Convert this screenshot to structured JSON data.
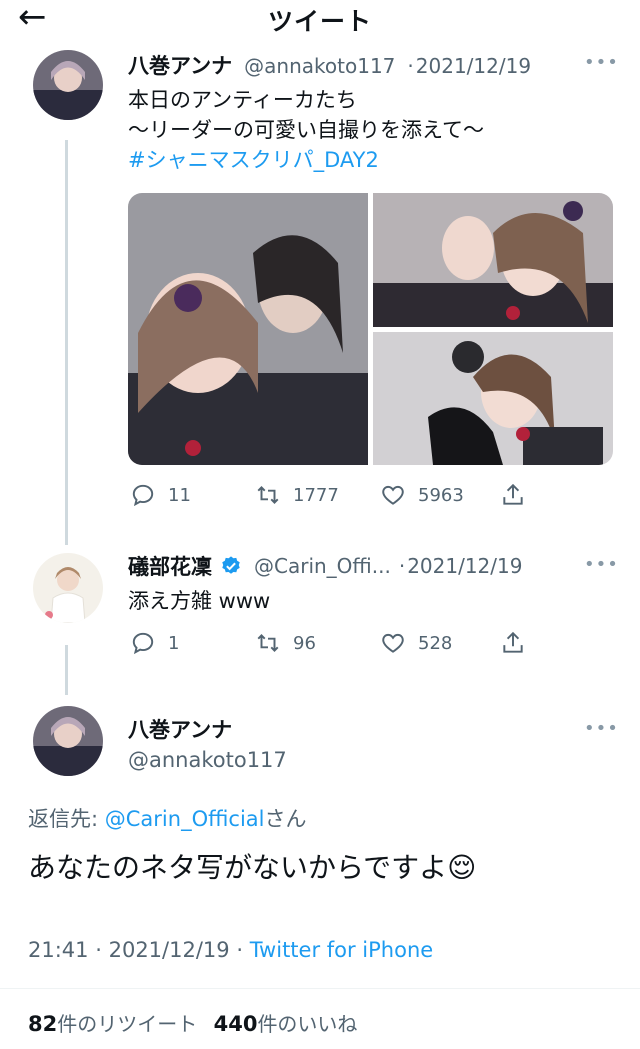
{
  "header": {
    "title": "ツイート"
  },
  "tweet1": {
    "name": "八巻アンナ",
    "handle": "@annakoto117",
    "date": "2021/12/19",
    "line1": "本日のアンティーカたち",
    "line2": "〜リーダーの可愛い自撮りを添えて〜",
    "hashtag": "#シャニマスクリパ_DAY2",
    "replies": "11",
    "retweets": "1777",
    "likes": "5963"
  },
  "tweet2": {
    "name": "礒部花凜",
    "handle": "@Carin_Offi...",
    "date": "2021/12/19",
    "text": "添え方雑 www",
    "replies": "1",
    "retweets": "96",
    "likes": "528"
  },
  "main": {
    "name": "八巻アンナ",
    "handle": "@annakoto117",
    "reply_prefix": "返信先:",
    "reply_to": "@Carin_Official",
    "reply_suffix": "さん",
    "text": "あなたのネタ写がないからですよ",
    "emoji": "😌",
    "time": "21:41",
    "date": "2021/12/19",
    "client": "Twitter for iPhone",
    "retweet_count": "82",
    "retweet_label": "件のリツイート",
    "like_count": "440",
    "like_label": "件のいいね"
  },
  "colors": {
    "link": "#1d9bf0",
    "verified": "#1d9bf0",
    "muted": "#536471"
  }
}
